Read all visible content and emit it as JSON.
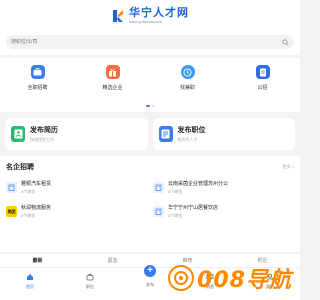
{
  "header": {
    "title": "华宁人才网",
    "subtitle": "www.yuhnrcw.com"
  },
  "search": {
    "placeholder": "搜职位/公司"
  },
  "categories": [
    {
      "label": "全职招聘",
      "icon": "briefcase-icon",
      "color": "#3a7df5"
    },
    {
      "label": "精选企业",
      "icon": "gift-icon",
      "color": "#ff6a3d"
    },
    {
      "label": "找兼职",
      "icon": "clock-icon",
      "color": "#3a9bf5"
    },
    {
      "label": "公招",
      "icon": "document-icon",
      "color": "#2f6de6"
    }
  ],
  "post_cards": [
    {
      "title": "发布简历",
      "subtitle": "快速找到工作",
      "icon": "resume-icon",
      "color": "#2fb872"
    },
    {
      "title": "发布职位",
      "subtitle": "招优秀人才",
      "icon": "job-post-icon",
      "color": "#3a7df5"
    }
  ],
  "companies_section": {
    "title": "名企招聘",
    "more": "更多 >",
    "items": [
      {
        "name": "雅颖汽车租赁",
        "jobs": "4个岗位",
        "logo": "building-icon",
        "logo_color": "#e9f1fe"
      },
      {
        "name": "云南采茵企业管理苏州分公",
        "jobs": "4个岗位",
        "logo": "building-icon",
        "logo_color": "#e9f1fe"
      },
      {
        "name": "秋润物流服务",
        "jobs": "3个岗位",
        "logo_text": "美团",
        "logo_color": "#ffd100"
      },
      {
        "name": "华宁宁州宁山居餐饮店",
        "jobs": "3个岗位",
        "logo": "building-icon",
        "logo_color": "#e9f1fe"
      }
    ]
  },
  "tabs": [
    {
      "label": "最新",
      "active": true
    },
    {
      "label": "紧急",
      "active": false
    },
    {
      "label": "推荐",
      "active": false
    },
    {
      "label": "附近",
      "active": false
    }
  ],
  "bottom_nav": [
    {
      "label": "首页",
      "icon": "home-icon",
      "active": true
    },
    {
      "label": "职位",
      "icon": "bag-icon",
      "active": false
    },
    {
      "label": "发布",
      "icon": "plus-icon",
      "active": false
    },
    {
      "label": "消息",
      "icon": "chat-icon",
      "active": false
    },
    {
      "label": "我的",
      "icon": "user-icon",
      "active": false
    }
  ],
  "watermark": {
    "text": "008导航"
  }
}
